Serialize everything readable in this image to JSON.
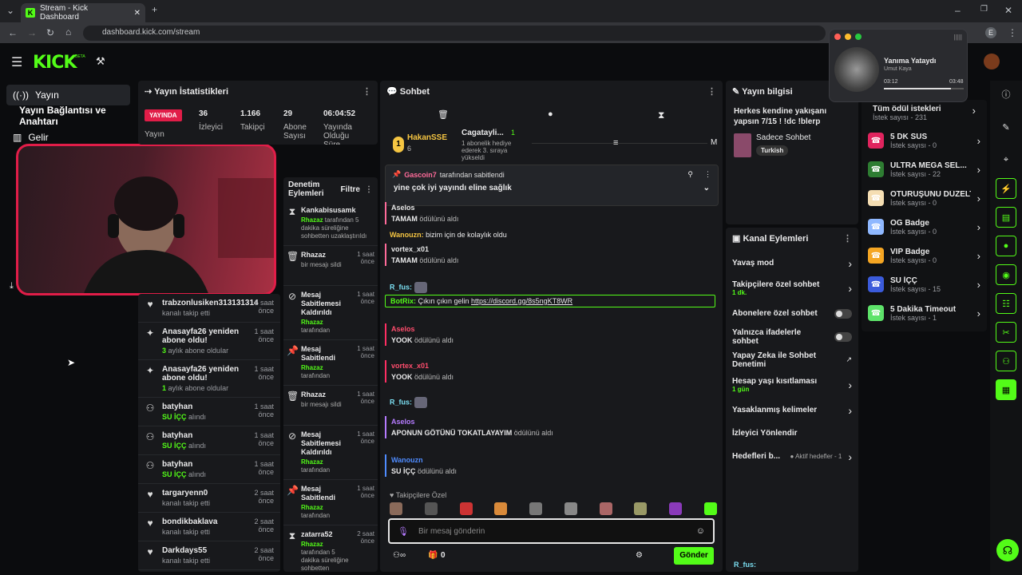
{
  "browser": {
    "tab_title": "Stream - Kick Dashboard",
    "url": "dashboard.kick.com/stream",
    "profile": "E"
  },
  "header": {
    "logo": "KICK",
    "beta": "BETA"
  },
  "sidebar": {
    "items": [
      {
        "label": "Yayın"
      },
      {
        "label": "Yayın Bağlantısı ve Anahtarı"
      },
      {
        "label": "Gelir"
      }
    ]
  },
  "stats": {
    "title": "Yayın İstatistikleri",
    "badge": "YAYINDA",
    "label0": "Yayın",
    "items": [
      {
        "value": "36",
        "label": "İzleyici"
      },
      {
        "value": "1.166",
        "label": "Takipçi"
      },
      {
        "value": "29",
        "label": "Abone Sayısı"
      },
      {
        "value": "06:04:52",
        "label": "Yayında Olduğu Süre"
      }
    ]
  },
  "activity": {
    "rows": [
      {
        "name": "trabzonlusiken313131314",
        "sub": "kanalı takip etti",
        "time": "1 saat önce",
        "icon": "heart-icon"
      },
      {
        "name": "Anasayfa26 yeniden abone oldu!",
        "sub_strong": "3",
        "sub": "aylık abone oldular",
        "time": "1 saat önce",
        "icon": "sparkle-icon"
      },
      {
        "name": "Anasayfa26 yeniden abone oldu!",
        "sub_strong": "1",
        "sub": "aylık abone oldular",
        "time": "1 saat önce",
        "icon": "sparkle-icon"
      },
      {
        "name": "batyhan",
        "sub_strong": "SU İÇÇ",
        "sub": "alındı",
        "time": "1 saat önce",
        "icon": "reward-icon"
      },
      {
        "name": "batyhan",
        "sub_strong": "SU İÇÇ",
        "sub": "alındı",
        "time": "1 saat önce",
        "icon": "reward-icon"
      },
      {
        "name": "batyhan",
        "sub_strong": "SU İÇÇ",
        "sub": "alındı",
        "time": "1 saat önce",
        "icon": "reward-icon"
      },
      {
        "name": "targaryenn0",
        "sub": "kanalı takip etti",
        "time": "2 saat önce",
        "icon": "heart-icon"
      },
      {
        "name": "bondikbaklava",
        "sub": "kanalı takip etti",
        "time": "2 saat önce",
        "icon": "heart-icon"
      },
      {
        "name": "Darkdays55",
        "sub": "kanalı takip etti",
        "time": "2 saat önce",
        "icon": "heart-icon"
      }
    ]
  },
  "moderation": {
    "title": "Denetim Eylemleri",
    "filter": "Filtre",
    "rows": [
      {
        "title": "Kankabisusamk",
        "by": "Rhazaz",
        "detail": "tarafından 5 dakika süreliğine sohbetten uzaklaştırıldı",
        "time": "",
        "icon": "hourglass-icon"
      },
      {
        "title": "Rhazaz",
        "detail": "bir mesajı sildi",
        "time": "1 saat önce",
        "icon": "trash-icon"
      },
      {
        "title": "Mesaj Sabitlemesi Kaldırıldı",
        "by": "Rhazaz",
        "detail": "tarafından",
        "time": "1 saat önce",
        "icon": "unpin-icon"
      },
      {
        "title": "Mesaj Sabitlendi",
        "by": "Rhazaz",
        "detail": "tarafından",
        "time": "1 saat önce",
        "icon": "pin-icon"
      },
      {
        "title": "Rhazaz",
        "detail": "bir mesajı sildi",
        "time": "1 saat önce",
        "icon": "trash-icon"
      },
      {
        "title": "Mesaj Sabitlemesi Kaldırıldı",
        "by": "Rhazaz",
        "detail": "tarafından",
        "time": "1 saat önce",
        "icon": "unpin-icon"
      },
      {
        "title": "Mesaj Sabitlendi",
        "by": "Rhazaz",
        "detail": "tarafından",
        "time": "1 saat önce",
        "icon": "pin-icon"
      },
      {
        "title": "zatarra52",
        "by": "Rhazaz",
        "detail": "tarafından 5 dakika süreliğine sohbetten uzaklaştırıldı",
        "time": "2 saat önce",
        "icon": "hourglass-icon"
      }
    ]
  },
  "chat": {
    "title": "Sohbet",
    "top_user": "HakanSSE",
    "top_count": "6",
    "gift_user": "Cagatayli...",
    "gift_count": "1",
    "gift_text": "1 abonelik hediye ederek 3. sıraya yükseldi",
    "rank": "1",
    "m": "M",
    "pinned": {
      "user": "Gascoin7",
      "by": "tarafından sabitlendi",
      "text": "yine çok iyi yayındı eline sağlık"
    },
    "messages": [
      {
        "user": "Aselos",
        "color": "#e8e8e8",
        "action": "TAMAM",
        "suffix": "ödülünü aldı",
        "bar": "#ff6b9a"
      },
      {
        "user": "Wanouzn",
        "color": "#f5c542",
        "text": "bizim için de kolaylık oldu"
      },
      {
        "user": "vortex_x01",
        "color": "#e8e8e8",
        "action": "TAMAM",
        "suffix": "ödülünü aldı",
        "bar": "#ff6b9a"
      },
      {
        "user": "R_fus",
        "color": "#7bdff2",
        "text": ""
      },
      {
        "user": "BotRix",
        "color": "#53fc18",
        "text": "Çıkın çıkın gelin",
        "link": "https://discord.gg/8s5ngKT8WR"
      },
      {
        "user": "Aselos",
        "color": "#ff4d6d",
        "action": "YOOK",
        "suffix": "ödülünü aldı",
        "bar": "#ff2e63"
      },
      {
        "user": "vortex_x01",
        "color": "#ff4d6d",
        "action": "YOOK",
        "suffix": "ödülünü aldı",
        "bar": "#ff2e63"
      },
      {
        "user": "R_fus",
        "color": "#7bdff2",
        "text": ""
      },
      {
        "user": "Aselos",
        "color": "#b57bff",
        "action": "APONUN GÖTÜNÜ TOKATLAYAYIM",
        "suffix": "ödülünü aldı",
        "bar": "#b57bff"
      },
      {
        "user": "Wanouzn",
        "color": "#4f8cff",
        "action": "SU İÇÇ",
        "suffix": "ödülünü aldı",
        "bar": "#4f8cff"
      }
    ],
    "emote_label": "Takipçilere Özel",
    "input_placeholder": "Bir mesaj gönderin",
    "points": "0",
    "send": "Gönder"
  },
  "stream_info": {
    "title": "Yayın bilgisi",
    "stream_title": "Herkes kendine yakışanı yapsın 7/15 ! !dc !blerp",
    "category": "Sadece Sohbet",
    "tag": "Turkish"
  },
  "channel": {
    "title": "Kanal Eylemleri",
    "rows": [
      {
        "label": "Yavaş mod",
        "type": "arrow"
      },
      {
        "label": "Takipçilere özel sohbet",
        "sub": "1 dk.",
        "type": "arrow"
      },
      {
        "label": "Abonelere özel sohbet",
        "type": "toggle"
      },
      {
        "label": "Yalnızca ifadelerle sohbet",
        "type": "toggle"
      },
      {
        "label": "Yapay Zeka ile Sohbet Denetimi",
        "type": "ext"
      },
      {
        "label": "Hesap yaşı kısıtlaması",
        "sub": "1 gün",
        "type": "arrow"
      },
      {
        "label": "Yasaklanmış kelimeler",
        "type": "arrow"
      },
      {
        "label": "İzleyici Yönlendir",
        "type": "none"
      },
      {
        "label": "Hedefleri b...",
        "extra": "Aktif hedefler - 1",
        "type": "arrow"
      }
    ],
    "bottom_user": "R_fus:"
  },
  "rewards": {
    "all": "Tüm ödül istekleri",
    "all_sub": "İstek sayısı - 231",
    "items": [
      {
        "name": "5 DK SUS",
        "sub": "İstek sayısı - 0",
        "color": "#e0245e"
      },
      {
        "name": "ULTRA MEGA SEL...",
        "sub": "İstek sayısı - 22",
        "color": "#2e7d32"
      },
      {
        "name": "OTURUŞUNU DÜZELT",
        "sub": "İstek sayısı - 0",
        "color": "#f5deb3"
      },
      {
        "name": "OG Badge",
        "sub": "İstek sayısı - 0",
        "color": "#8fb8ff"
      },
      {
        "name": "VIP Badge",
        "sub": "İstek sayısı - 0",
        "color": "#f5a623"
      },
      {
        "name": "SU İÇÇ",
        "sub": "İstek sayısı - 15",
        "color": "#3b5bdb"
      },
      {
        "name": "5 Dakika Timeout",
        "sub": "İstek sayısı - 1",
        "color": "#5ee36a"
      }
    ]
  },
  "music": {
    "title": "Yanıma Yataydı",
    "artist": "Umut Kaya",
    "elapsed": "03:12",
    "total": "03:48",
    "progress": 0.84
  }
}
